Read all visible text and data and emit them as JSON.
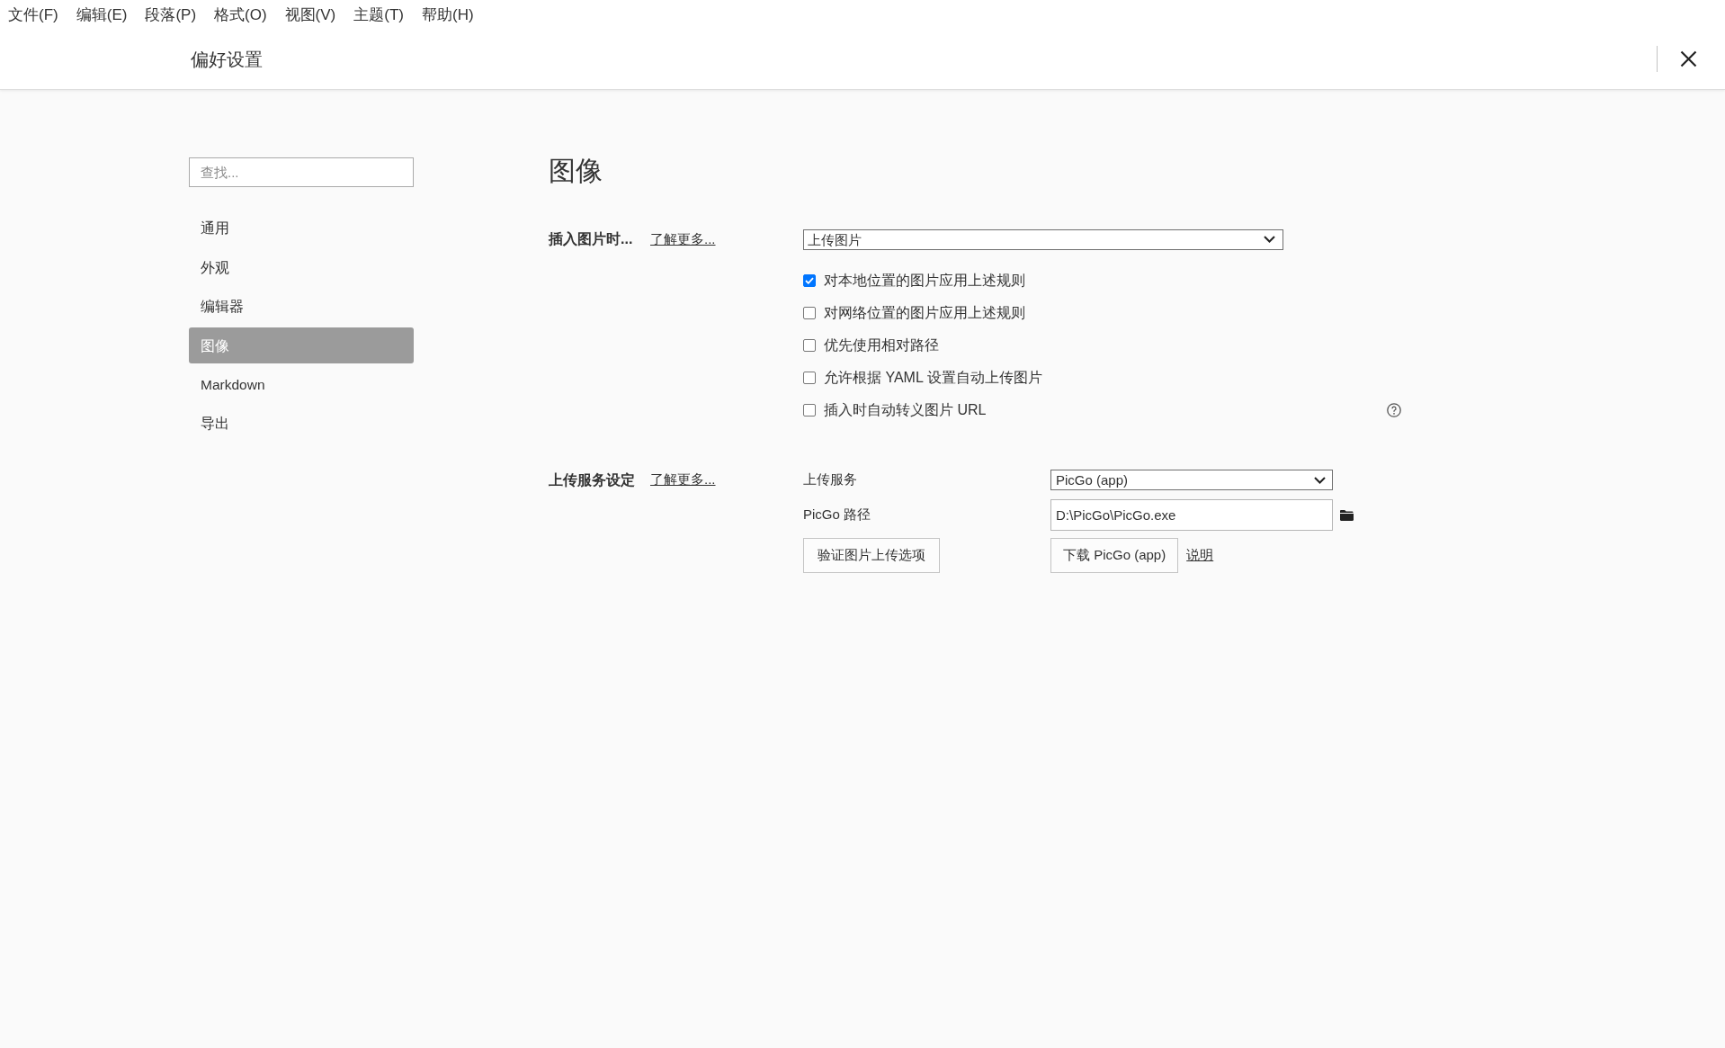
{
  "menu_bar": {
    "items": [
      "文件(F)",
      "编辑(E)",
      "段落(P)",
      "格式(O)",
      "视图(V)",
      "主题(T)",
      "帮助(H)"
    ]
  },
  "header": {
    "title": "偏好设置"
  },
  "sidebar": {
    "search": {
      "placeholder": "查找..."
    },
    "items": [
      {
        "label": "通用",
        "selected": false
      },
      {
        "label": "外观",
        "selected": false
      },
      {
        "label": "编辑器",
        "selected": false
      },
      {
        "label": "图像",
        "selected": true
      },
      {
        "label": "Markdown",
        "selected": false
      },
      {
        "label": "导出",
        "selected": false
      }
    ]
  },
  "content": {
    "title": "图像",
    "insert_image": {
      "label": "插入图片时...",
      "link": "了解更多...",
      "action": {
        "value": "上传图片"
      },
      "options": [
        {
          "label": "对本地位置的图片应用上述规则",
          "checked": true
        },
        {
          "label": "对网络位置的图片应用上述规则",
          "checked": false
        },
        {
          "label": "优先使用相对路径",
          "checked": false
        },
        {
          "label": "允许根据 YAML 设置自动上传图片",
          "checked": false
        },
        {
          "label": "插入时自动转义图片 URL",
          "checked": false
        }
      ]
    },
    "upload_service": {
      "label": "上传服务设定",
      "link": "了解更多...",
      "service": {
        "label": "上传服务",
        "value": "PicGo (app)"
      },
      "path": {
        "label": "PicGo 路径",
        "value": "D:\\PicGo\\PicGo.exe"
      },
      "validate_button": "验证图片上传选项",
      "download_button": "下载 PicGo (app)",
      "help_link": "说明"
    }
  }
}
